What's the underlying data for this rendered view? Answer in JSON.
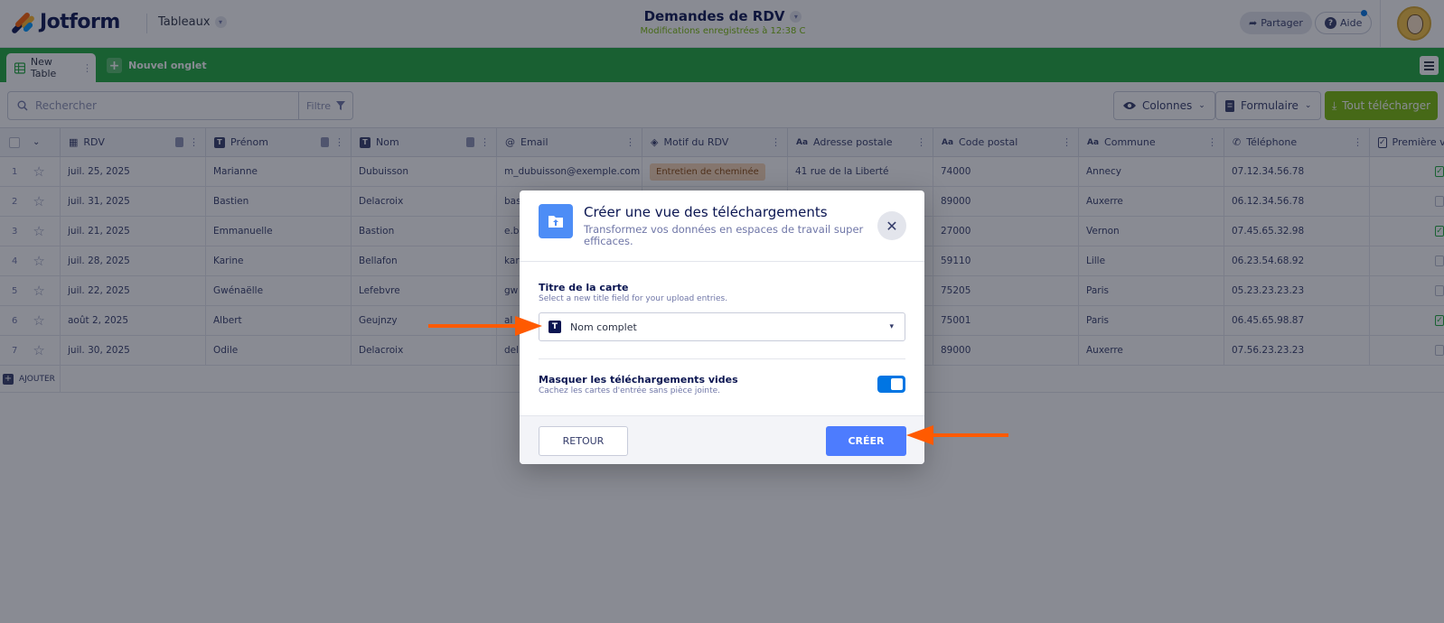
{
  "app": {
    "brand": "Jotform",
    "section": "Tableaux",
    "doc_title": "Demandes de RDV",
    "save_status": "Modifications enregistrées à 12:38 C",
    "share_label": "Partager",
    "help_label": "Aide"
  },
  "tabs": {
    "active": "New Table",
    "new_tab": "Nouvel onglet"
  },
  "toolbar": {
    "search_placeholder": "Rechercher",
    "filter_label": "Filtre",
    "columns_label": "Colonnes",
    "form_label": "Formulaire",
    "download_label": "Tout télécharger"
  },
  "table": {
    "columns": [
      "RDV",
      "Prénom",
      "Nom",
      "Email",
      "Motif du RDV",
      "Adresse postale",
      "Code postal",
      "Commune",
      "Téléphone",
      "Première v"
    ],
    "rows": [
      {
        "n": "1",
        "rdv": "juil. 25, 2025",
        "prenom": "Marianne",
        "nom": "Dubuisson",
        "email": "m_dubuisson@exemple.com",
        "motif": "Entretien de cheminée",
        "adresse": "41 rue de la Liberté",
        "cp": "74000",
        "commune": "Annecy",
        "tel": "07.12.34.56.78",
        "premiere": true
      },
      {
        "n": "2",
        "rdv": "juil. 31, 2025",
        "prenom": "Bastien",
        "nom": "Delacroix",
        "email": "bas",
        "motif": "",
        "adresse": "",
        "cp": "89000",
        "commune": "Auxerre",
        "tel": "06.12.34.56.78",
        "premiere": false
      },
      {
        "n": "3",
        "rdv": "juil. 21, 2025",
        "prenom": "Emmanuelle",
        "nom": "Bastion",
        "email": "e.b",
        "motif": "",
        "adresse": "",
        "cp": "27000",
        "commune": "Vernon",
        "tel": "07.45.65.32.98",
        "premiere": true
      },
      {
        "n": "4",
        "rdv": "juil. 28, 2025",
        "prenom": "Karine",
        "nom": "Bellafon",
        "email": "kar",
        "motif": "",
        "adresse": "",
        "cp": "59110",
        "commune": "Lille",
        "tel": "06.23.54.68.92",
        "premiere": false
      },
      {
        "n": "5",
        "rdv": "juil. 22, 2025",
        "prenom": "Gwénaëlle",
        "nom": "Lefebvre",
        "email": "gw",
        "motif": "",
        "adresse": "",
        "cp": "75205",
        "commune": "Paris",
        "tel": "05.23.23.23.23",
        "premiere": false
      },
      {
        "n": "6",
        "rdv": "août 2, 2025",
        "prenom": "Albert",
        "nom": "Geujnzy",
        "email": "al",
        "motif": "",
        "adresse": "",
        "cp": "75001",
        "commune": "Paris",
        "tel": "06.45.65.98.87",
        "premiere": true
      },
      {
        "n": "7",
        "rdv": "juil. 30, 2025",
        "prenom": "Odile",
        "nom": "Delacroix",
        "email": "del",
        "motif": "",
        "adresse": "",
        "cp": "89000",
        "commune": "Auxerre",
        "tel": "07.56.23.23.23",
        "premiere": false
      }
    ],
    "add_label": "AJOUTER"
  },
  "modal": {
    "title": "Créer une vue des téléchargements",
    "subtitle": "Transformez vos données en espaces de travail super efficaces.",
    "field_label": "Titre de la carte",
    "field_help": "Select a new title field for your upload entries.",
    "field_value": "Nom complet",
    "field_icon_letter": "T",
    "toggle_label": "Masquer les téléchargements vides",
    "toggle_help": "Cachez les cartes d'entrée sans pièce jointe.",
    "toggle_on": true,
    "back_label": "RETOUR",
    "create_label": "CRÉER"
  },
  "colors": {
    "tabbar": "#1ea83c",
    "download": "#78bb07",
    "primary": "#4d7cfe",
    "arrow": "#ff5a00"
  }
}
